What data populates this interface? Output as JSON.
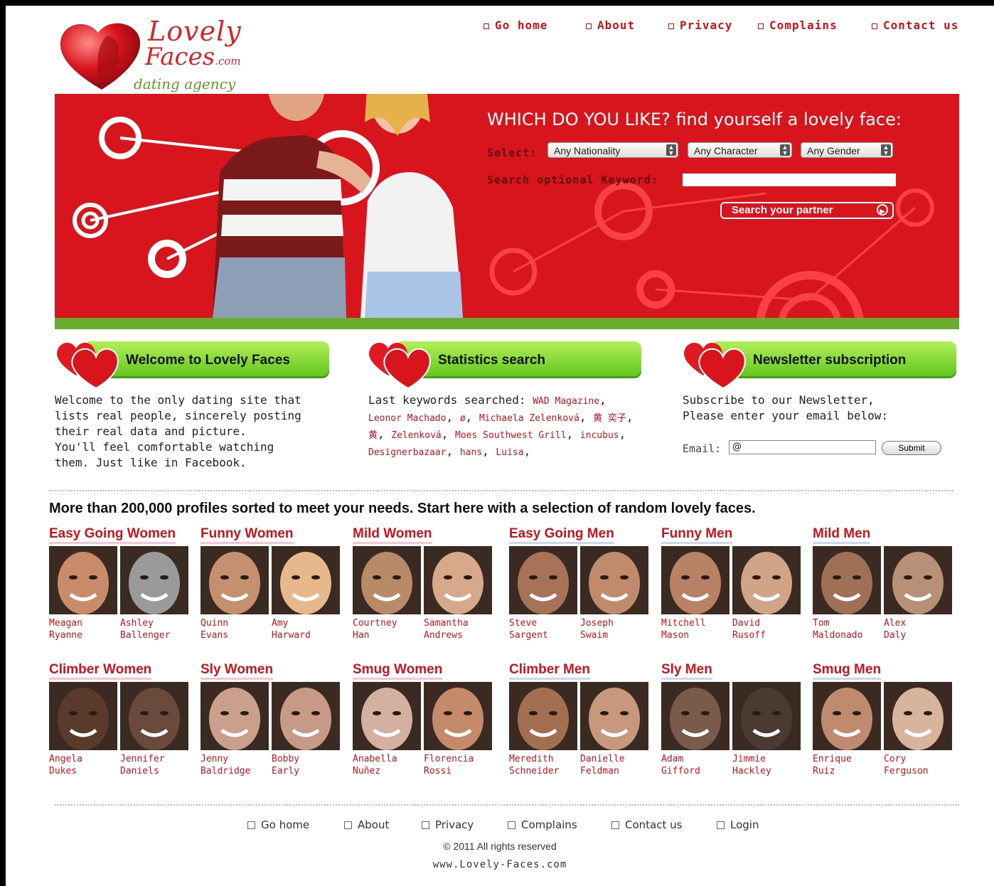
{
  "logo": {
    "line1": "Lovely",
    "line2": "Faces",
    "line2_small": ".com",
    "line3": "dating agency"
  },
  "nav": [
    {
      "label": "Go home"
    },
    {
      "label": "About"
    },
    {
      "label": "Privacy"
    },
    {
      "label": "Complains"
    },
    {
      "label": "Contact us"
    }
  ],
  "banner": {
    "title": "WHICH DO YOU LIKE? find yourself a lovely face:",
    "select_label": "Select:",
    "search_label": "Search optional Keyword:",
    "selects": [
      "Any Nationality",
      "Any Character",
      "Any Gender"
    ],
    "keyword_value": "",
    "button_label": "Search your partner",
    "colors": {
      "red": "#d8141c",
      "green": "#6aac2c"
    }
  },
  "welcome": {
    "title": "Welcome to Lovely Faces",
    "lines": [
      "Welcome to the only dating site that",
      "lists real people, sincerely posting",
      "their real data and picture.",
      "You'll feel comfortable watching",
      "them. Just like in Facebook."
    ]
  },
  "stats": {
    "title": "Statistics search",
    "intro": "Last keywords searched:",
    "keywords": [
      "WAD Magazine",
      "Leonor Machado",
      "ø",
      "Michaela Zelenková",
      "黄 奕子",
      "黄",
      "Zelenková",
      "Moes Southwest Grill",
      "incubus",
      "Designerbazaar",
      "hans",
      "Luisa"
    ]
  },
  "newsletter": {
    "title": "Newsletter subscription",
    "lines": [
      "Subscribe to our Newsletter,",
      "Please enter your email below:"
    ],
    "email_label": "Email:",
    "email_value": "@",
    "submit_label": "Submit"
  },
  "profiles_heading": "More than 200,000 profiles sorted to meet your needs. Start here with a selection of random lovely faces.",
  "categories": [
    {
      "title": "Easy Going Women",
      "people": [
        [
          "Meagan",
          "Ryanne"
        ],
        [
          "Ashley",
          "Ballenger"
        ]
      ]
    },
    {
      "title": "Funny Women",
      "people": [
        [
          "Quinn",
          "Evans"
        ],
        [
          "Amy",
          "Harward"
        ]
      ]
    },
    {
      "title": "Mild Women",
      "people": [
        [
          "Courtney",
          "Han"
        ],
        [
          "Samantha",
          "Andrews"
        ]
      ]
    },
    {
      "title": "Easy Going Men",
      "people": [
        [
          "Steve",
          "Sargent"
        ],
        [
          "Joseph",
          "Swaim"
        ]
      ]
    },
    {
      "title": "Funny Men",
      "people": [
        [
          "Mitchell",
          "Mason"
        ],
        [
          "David",
          "Rusoff"
        ]
      ]
    },
    {
      "title": "Mild Men",
      "people": [
        [
          "Tom",
          "Maldonado"
        ],
        [
          "Alex",
          "Daly"
        ]
      ]
    },
    {
      "title": "Climber Women",
      "people": [
        [
          "Angela",
          "Dukes"
        ],
        [
          "Jennifer",
          "Daniels"
        ]
      ]
    },
    {
      "title": "Sly Women",
      "people": [
        [
          "Jenny",
          "Baldridge"
        ],
        [
          "Bobby",
          "Early"
        ]
      ]
    },
    {
      "title": "Smug Women",
      "people": [
        [
          "Anabella",
          "Nuñez"
        ],
        [
          "Florencia",
          "Rossi"
        ]
      ]
    },
    {
      "title": "Climber Men",
      "people": [
        [
          "Meredith",
          "Schneider"
        ],
        [
          "Danielle",
          "Feldman"
        ]
      ]
    },
    {
      "title": "Sly Men",
      "people": [
        [
          "Adam",
          "Gifford"
        ],
        [
          "Jimmie",
          "Hackley"
        ]
      ]
    },
    {
      "title": "Smug Men",
      "people": [
        [
          "Enrique",
          "Ruiz"
        ],
        [
          "Cory",
          "Ferguson"
        ]
      ]
    }
  ],
  "footer": {
    "links": [
      "Go home",
      "About",
      "Privacy",
      "Complains",
      "Contact us",
      "Login"
    ],
    "copyright": "© 2011 All rights reserved",
    "url": "www.Lovely-Faces.com"
  }
}
